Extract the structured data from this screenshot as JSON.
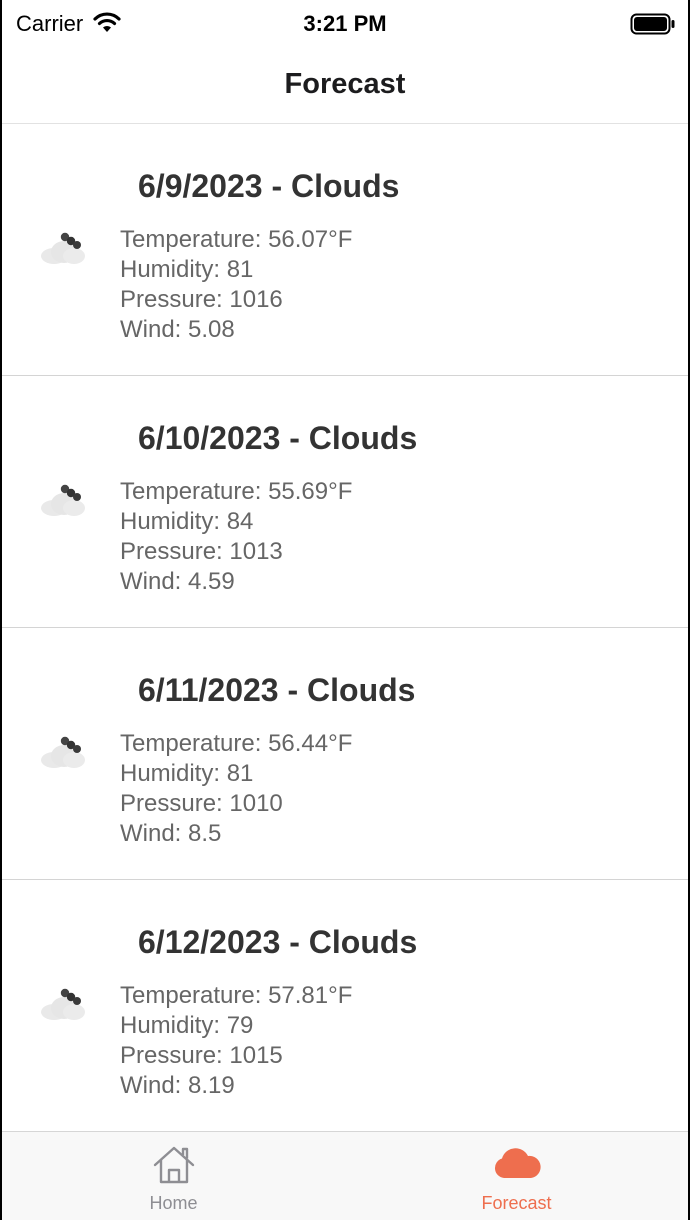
{
  "status_bar": {
    "carrier": "Carrier",
    "time": "3:21 PM"
  },
  "nav": {
    "title": "Forecast"
  },
  "forecast": [
    {
      "title": "6/9/2023 - Clouds",
      "temperature": "Temperature: 56.07°F",
      "humidity": "Humidity: 81",
      "pressure": "Pressure: 1016",
      "wind": "Wind: 5.08",
      "icon": "cloud-icon"
    },
    {
      "title": "6/10/2023 - Clouds",
      "temperature": "Temperature: 55.69°F",
      "humidity": "Humidity: 84",
      "pressure": "Pressure: 1013",
      "wind": "Wind: 4.59",
      "icon": "cloud-icon"
    },
    {
      "title": "6/11/2023 - Clouds",
      "temperature": "Temperature: 56.44°F",
      "humidity": "Humidity: 81",
      "pressure": "Pressure: 1010",
      "wind": "Wind: 8.5",
      "icon": "cloud-icon"
    },
    {
      "title": "6/12/2023 - Clouds",
      "temperature": "Temperature: 57.81°F",
      "humidity": "Humidity: 79",
      "pressure": "Pressure: 1015",
      "wind": "Wind: 8.19",
      "icon": "cloud-icon"
    }
  ],
  "tabs": [
    {
      "label": "Home",
      "icon": "home-icon",
      "active": false
    },
    {
      "label": "Forecast",
      "icon": "cloud-icon",
      "active": true
    }
  ],
  "colors": {
    "accent": "#ee6e4e",
    "inactive_tab": "#8e8e93",
    "title_text": "#333333",
    "detail_text": "#666666"
  }
}
